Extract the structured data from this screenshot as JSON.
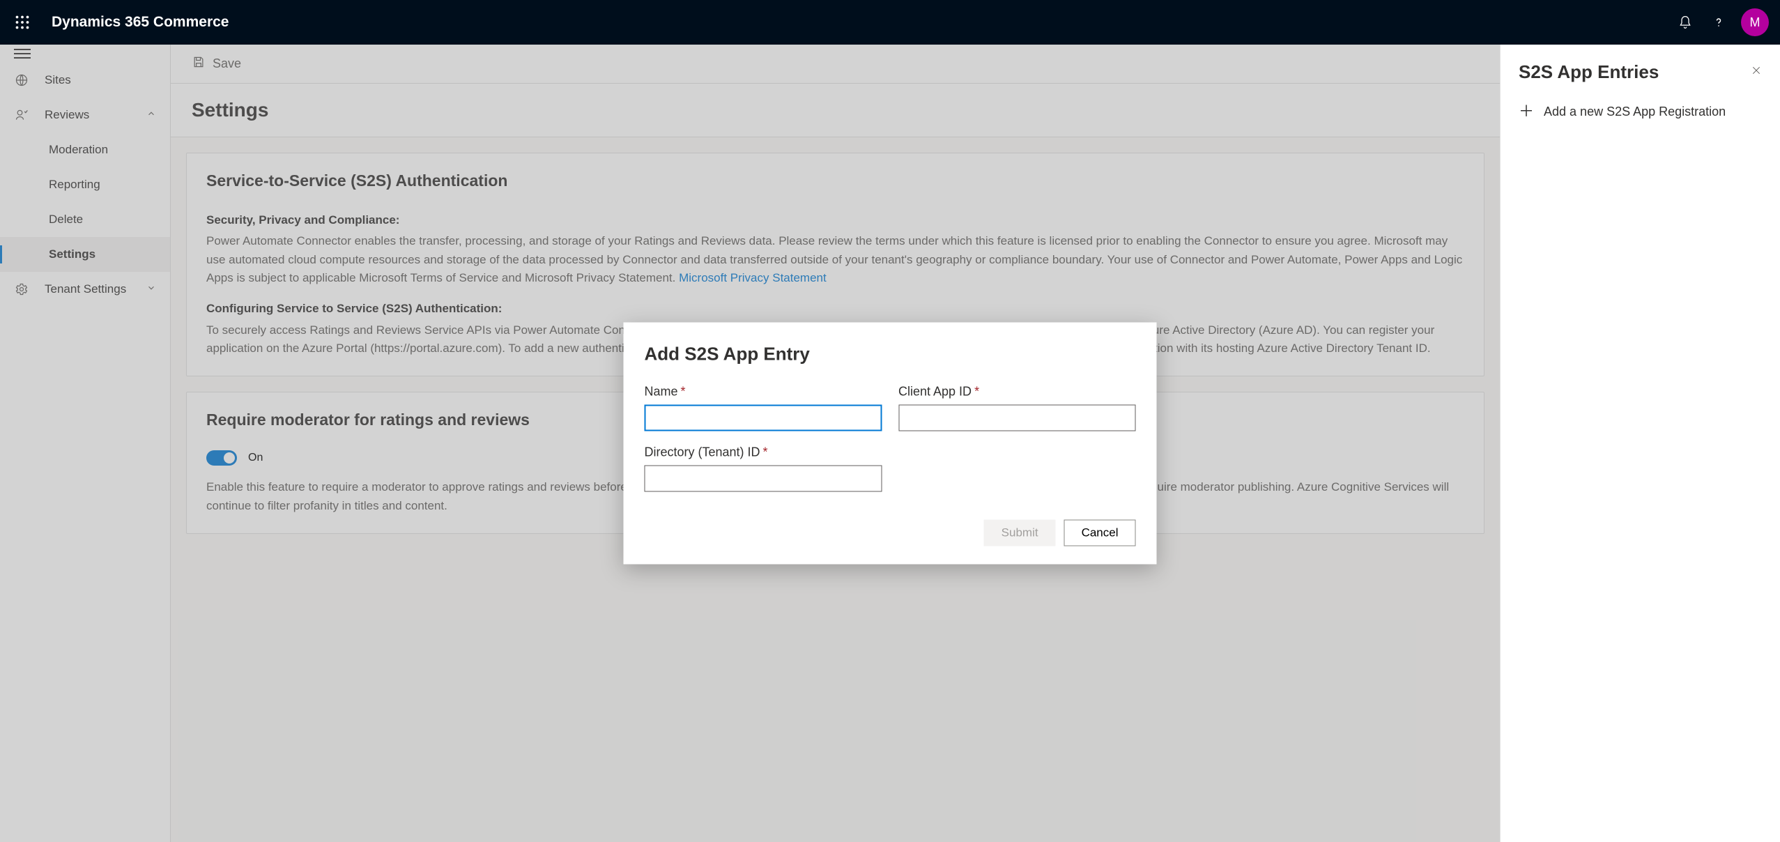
{
  "topbar": {
    "brand": "Dynamics 365 Commerce",
    "avatar_initial": "M"
  },
  "leftnav": {
    "items": [
      {
        "label": "Sites"
      },
      {
        "label": "Reviews"
      },
      {
        "label": "Moderation"
      },
      {
        "label": "Reporting"
      },
      {
        "label": "Delete"
      },
      {
        "label": "Settings"
      },
      {
        "label": "Tenant Settings"
      }
    ]
  },
  "cmdbar": {
    "save": "Save"
  },
  "page": {
    "title": "Settings"
  },
  "card_s2s": {
    "heading": "Service-to-Service (S2S) Authentication",
    "subheading": "Security, Privacy and Compliance:",
    "body1": "Power Automate Connector enables the transfer, processing, and storage of your Ratings and Reviews data. Please review the terms under which this feature is licensed prior to enabling the Connector to ensure you agree. Microsoft may use automated cloud compute resources and storage of the data processed by Connector and data transferred outside of your tenant's geography or compliance boundary. Your use of Connector and Power Automate, Power Apps and Logic Apps is subject to applicable Microsoft Terms of Service and Microsoft Privacy Statement.",
    "link1": "Microsoft Privacy Statement",
    "subheading2": "Configuring Service to Service (S2S) Authentication:",
    "body2": "To securely access Ratings and Reviews Service APIs via Power Automate Connector or custom application, the connector or application will need to be registered with Microsoft Azure Active Directory (Azure AD). You can register your application on the Azure Portal (https://portal.azure.com). To add a new authentication entry, click 'Add a new S2S App Entry' and enter Client ID assigned to the connector or application with its hosting Azure Active Directory Tenant ID."
  },
  "card_mod": {
    "heading": "Require moderator for ratings and reviews",
    "toggle_label": "On",
    "body": "Enable this feature to require a moderator to approve ratings and reviews before publishing. Enabling this feature will also move ratings and reviews currently pending approval to require moderator publishing. Azure Cognitive Services will continue to filter profanity in titles and content."
  },
  "rightpane": {
    "title": "S2S App Entries",
    "add_link": "Add a new S2S App Registration"
  },
  "dialog": {
    "title": "Add S2S App Entry",
    "fields": {
      "name_label": "Name",
      "client_app_id_label": "Client App ID",
      "tenant_id_label": "Directory (Tenant) ID"
    },
    "submit": "Submit",
    "cancel": "Cancel"
  }
}
